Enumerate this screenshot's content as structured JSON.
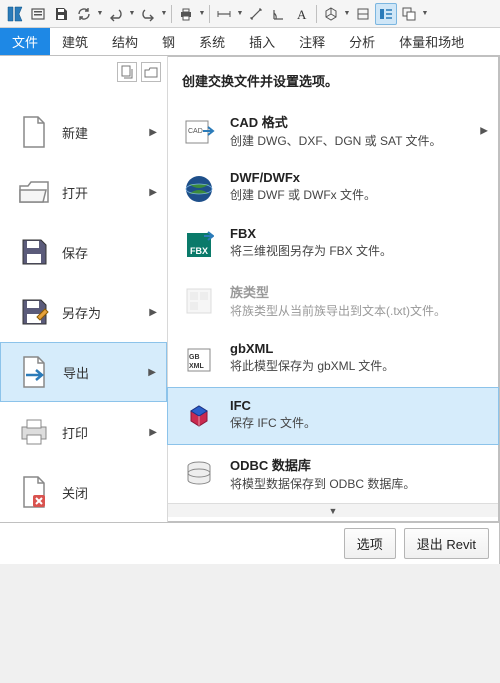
{
  "tabs": {
    "file": "文件",
    "architecture": "建筑",
    "structure": "结构",
    "steel": "钢",
    "systems": "系统",
    "insert": "插入",
    "annotate": "注释",
    "analyze": "分析",
    "massing": "体量和场地"
  },
  "left": {
    "new": "新建",
    "open": "打开",
    "save": "保存",
    "saveas": "另存为",
    "export": "导出",
    "print": "打印",
    "close": "关闭"
  },
  "right": {
    "header": "创建交换文件并设置选项。",
    "cad": {
      "title": "CAD 格式",
      "desc": "创建 DWG、DXF、DGN 或 SAT 文件。"
    },
    "dwf": {
      "title": "DWF/DWFx",
      "desc": "创建 DWF 或 DWFx 文件。"
    },
    "fbx": {
      "title": "FBX",
      "desc": "将三维视图另存为 FBX 文件。"
    },
    "family": {
      "title": "族类型",
      "desc": "将族类型从当前族导出到文本(.txt)文件。"
    },
    "gbxml": {
      "title": "gbXML",
      "desc": "将此模型保存为 gbXML 文件。"
    },
    "ifc": {
      "title": "IFC",
      "desc": "保存 IFC 文件。"
    },
    "odbc": {
      "title": "ODBC 数据库",
      "desc": "将模型数据保存到 ODBC 数据库。"
    }
  },
  "footer": {
    "options": "选项",
    "exit": "退出 Revit"
  }
}
